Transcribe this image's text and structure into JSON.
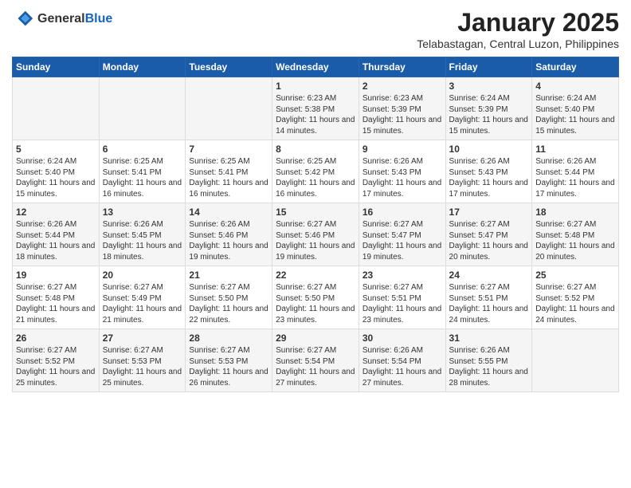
{
  "header": {
    "logo_general": "General",
    "logo_blue": "Blue",
    "month_title": "January 2025",
    "location": "Telabastagan, Central Luzon, Philippines"
  },
  "weekdays": [
    "Sunday",
    "Monday",
    "Tuesday",
    "Wednesday",
    "Thursday",
    "Friday",
    "Saturday"
  ],
  "weeks": [
    [
      {
        "day": "",
        "info": ""
      },
      {
        "day": "",
        "info": ""
      },
      {
        "day": "",
        "info": ""
      },
      {
        "day": "1",
        "info": "Sunrise: 6:23 AM\nSunset: 5:38 PM\nDaylight: 11 hours and 14 minutes."
      },
      {
        "day": "2",
        "info": "Sunrise: 6:23 AM\nSunset: 5:39 PM\nDaylight: 11 hours and 15 minutes."
      },
      {
        "day": "3",
        "info": "Sunrise: 6:24 AM\nSunset: 5:39 PM\nDaylight: 11 hours and 15 minutes."
      },
      {
        "day": "4",
        "info": "Sunrise: 6:24 AM\nSunset: 5:40 PM\nDaylight: 11 hours and 15 minutes."
      }
    ],
    [
      {
        "day": "5",
        "info": "Sunrise: 6:24 AM\nSunset: 5:40 PM\nDaylight: 11 hours and 15 minutes."
      },
      {
        "day": "6",
        "info": "Sunrise: 6:25 AM\nSunset: 5:41 PM\nDaylight: 11 hours and 16 minutes."
      },
      {
        "day": "7",
        "info": "Sunrise: 6:25 AM\nSunset: 5:41 PM\nDaylight: 11 hours and 16 minutes."
      },
      {
        "day": "8",
        "info": "Sunrise: 6:25 AM\nSunset: 5:42 PM\nDaylight: 11 hours and 16 minutes."
      },
      {
        "day": "9",
        "info": "Sunrise: 6:26 AM\nSunset: 5:43 PM\nDaylight: 11 hours and 17 minutes."
      },
      {
        "day": "10",
        "info": "Sunrise: 6:26 AM\nSunset: 5:43 PM\nDaylight: 11 hours and 17 minutes."
      },
      {
        "day": "11",
        "info": "Sunrise: 6:26 AM\nSunset: 5:44 PM\nDaylight: 11 hours and 17 minutes."
      }
    ],
    [
      {
        "day": "12",
        "info": "Sunrise: 6:26 AM\nSunset: 5:44 PM\nDaylight: 11 hours and 18 minutes."
      },
      {
        "day": "13",
        "info": "Sunrise: 6:26 AM\nSunset: 5:45 PM\nDaylight: 11 hours and 18 minutes."
      },
      {
        "day": "14",
        "info": "Sunrise: 6:26 AM\nSunset: 5:46 PM\nDaylight: 11 hours and 19 minutes."
      },
      {
        "day": "15",
        "info": "Sunrise: 6:27 AM\nSunset: 5:46 PM\nDaylight: 11 hours and 19 minutes."
      },
      {
        "day": "16",
        "info": "Sunrise: 6:27 AM\nSunset: 5:47 PM\nDaylight: 11 hours and 19 minutes."
      },
      {
        "day": "17",
        "info": "Sunrise: 6:27 AM\nSunset: 5:47 PM\nDaylight: 11 hours and 20 minutes."
      },
      {
        "day": "18",
        "info": "Sunrise: 6:27 AM\nSunset: 5:48 PM\nDaylight: 11 hours and 20 minutes."
      }
    ],
    [
      {
        "day": "19",
        "info": "Sunrise: 6:27 AM\nSunset: 5:48 PM\nDaylight: 11 hours and 21 minutes."
      },
      {
        "day": "20",
        "info": "Sunrise: 6:27 AM\nSunset: 5:49 PM\nDaylight: 11 hours and 21 minutes."
      },
      {
        "day": "21",
        "info": "Sunrise: 6:27 AM\nSunset: 5:50 PM\nDaylight: 11 hours and 22 minutes."
      },
      {
        "day": "22",
        "info": "Sunrise: 6:27 AM\nSunset: 5:50 PM\nDaylight: 11 hours and 23 minutes."
      },
      {
        "day": "23",
        "info": "Sunrise: 6:27 AM\nSunset: 5:51 PM\nDaylight: 11 hours and 23 minutes."
      },
      {
        "day": "24",
        "info": "Sunrise: 6:27 AM\nSunset: 5:51 PM\nDaylight: 11 hours and 24 minutes."
      },
      {
        "day": "25",
        "info": "Sunrise: 6:27 AM\nSunset: 5:52 PM\nDaylight: 11 hours and 24 minutes."
      }
    ],
    [
      {
        "day": "26",
        "info": "Sunrise: 6:27 AM\nSunset: 5:52 PM\nDaylight: 11 hours and 25 minutes."
      },
      {
        "day": "27",
        "info": "Sunrise: 6:27 AM\nSunset: 5:53 PM\nDaylight: 11 hours and 25 minutes."
      },
      {
        "day": "28",
        "info": "Sunrise: 6:27 AM\nSunset: 5:53 PM\nDaylight: 11 hours and 26 minutes."
      },
      {
        "day": "29",
        "info": "Sunrise: 6:27 AM\nSunset: 5:54 PM\nDaylight: 11 hours and 27 minutes."
      },
      {
        "day": "30",
        "info": "Sunrise: 6:26 AM\nSunset: 5:54 PM\nDaylight: 11 hours and 27 minutes."
      },
      {
        "day": "31",
        "info": "Sunrise: 6:26 AM\nSunset: 5:55 PM\nDaylight: 11 hours and 28 minutes."
      },
      {
        "day": "",
        "info": ""
      }
    ]
  ]
}
